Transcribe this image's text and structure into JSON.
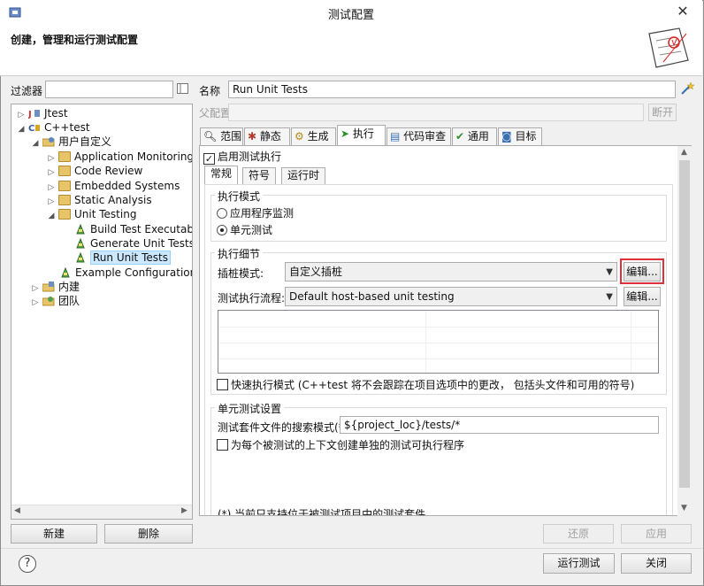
{
  "window": {
    "title": "测试配置",
    "close_glyph": "✕"
  },
  "header": {
    "text": "创建，管理和运行测试配置"
  },
  "filter": {
    "label": "过滤器",
    "value": ""
  },
  "name_field": {
    "label": "名称",
    "value": "Run Unit Tests"
  },
  "parent_field": {
    "label": "父配置",
    "value": "",
    "break_button": "断开"
  },
  "tree": {
    "items": [
      {
        "label": "Jtest",
        "toggle": "▷"
      },
      {
        "label": "C++test",
        "toggle": "◢"
      },
      {
        "label": "用户自定义",
        "toggle": "◢"
      },
      {
        "label": "Application Monitoring",
        "toggle": "▷"
      },
      {
        "label": "Code Review",
        "toggle": "▷"
      },
      {
        "label": "Embedded Systems",
        "toggle": "▷"
      },
      {
        "label": "Static Analysis",
        "toggle": "▷"
      },
      {
        "label": "Unit Testing",
        "toggle": "◢"
      },
      {
        "label": "Build Test Executable"
      },
      {
        "label": "Generate Unit Tests"
      },
      {
        "label": "Run Unit Tests",
        "selected": true
      },
      {
        "label": "Example Configuration"
      },
      {
        "label": "内建",
        "toggle": "▷"
      },
      {
        "label": "团队",
        "toggle": "▷"
      }
    ]
  },
  "left_buttons": {
    "new": "新建",
    "delete": "删除"
  },
  "tabs": [
    "范围",
    "静态",
    "生成",
    "执行",
    "代码审查",
    "通用",
    "目标"
  ],
  "tab_icons": [
    "magnifier-icon",
    "bug-icon",
    "gear-icon",
    "run-arrow-icon",
    "code-review-icon",
    "check-icon",
    "target-icon"
  ],
  "execution": {
    "enable_label": "启用测试执行",
    "enabled": true,
    "subtabs": [
      "常规",
      "符号",
      "运行时"
    ],
    "mode_group": {
      "title": "执行模式",
      "options": [
        "应用程序监测",
        "单元测试"
      ],
      "selected": "单元测试"
    },
    "details_group": {
      "title": "执行细节",
      "stub_label": "插桩模式:",
      "stub_value": "自定义插桩",
      "edit_label": "编辑...",
      "flow_label": "测试执行流程:",
      "flow_value": "Default host-based unit testing",
      "fast_mode_label": "快速执行模式 (C++test 将不会跟踪在项目选项中的更改， 包括头文件和可用的符号)"
    },
    "unit_group": {
      "title": "单元测试设置",
      "pattern_label": "测试套件文件的搜索模式(*):",
      "pattern_value": "${project_loc}/tests/*",
      "separate_label": "为每个被测试的上下文创建单独的测试可执行程序",
      "footnote": "(*) 当前只支持位于被测试项目中的测试套件"
    }
  },
  "bottom": {
    "revert": "还原",
    "apply": "应用",
    "run": "运行测试",
    "close": "关闭",
    "help_glyph": "?"
  },
  "colors": {
    "highlight_border": "#e0303a",
    "selection": "#cce8ff"
  }
}
